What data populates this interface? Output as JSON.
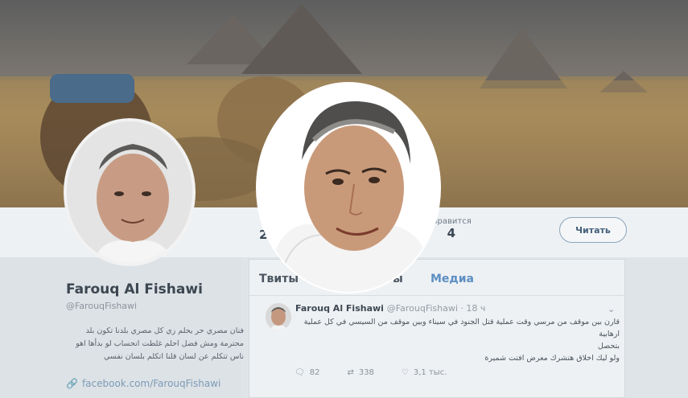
{
  "profile": {
    "name": "Farouq Al Fishawi",
    "handle": "@FarouqFishawi",
    "bio": "فنان مصري حر يحلم زي كل مصري بلدنا تكون بلد محترمة ومش فضل احلم غلطت انحساب لو بدأها اهو ناس تتكلم عن لسان قلنا اتكلم بلسان نفسي",
    "link": "facebook.com/FarouqFishawi"
  },
  "stats": {
    "tweets_count": "2",
    "likes_label": "Нравится",
    "likes_count": "4"
  },
  "follow_button": "Читать",
  "tabs": {
    "tweets": "Твиты",
    "replies": "ты",
    "media": "Медиа"
  },
  "tweet": {
    "author": "Farouq Al Fishawi",
    "handle": "@FarouqFishawi · 18 ч",
    "line1": "قارن بين موقف من مرسي وقت عملية قتل الجنود في سيناء وبين موقف من السيسي في كل عملية ارهابية",
    "line2": "بتحصل",
    "line3": "ولو ليك اخلاق هتشرك معرض افتت شميرة",
    "replies": "82",
    "retweets": "338",
    "likes": "3,1 тыс."
  },
  "icons": {
    "reply": "reply-icon",
    "retweet": "retweet-icon",
    "like": "heart-icon",
    "link": "link-icon",
    "menu": "chevron-down-icon"
  }
}
